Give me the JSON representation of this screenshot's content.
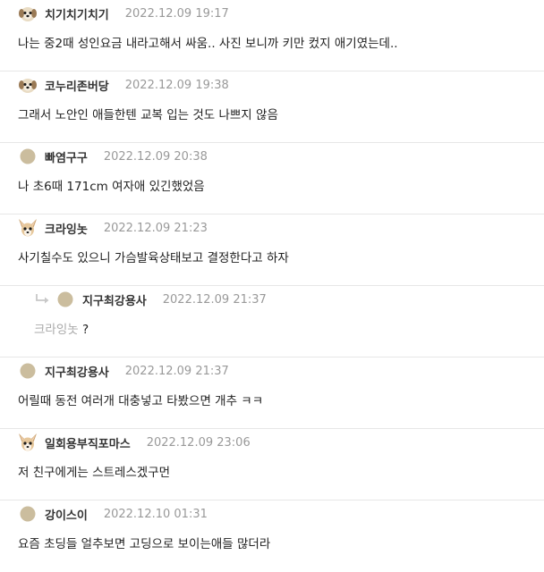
{
  "comments": [
    {
      "author": "치기치기치기",
      "time": "2022.12.09 19:17",
      "avatar": "puppy-avatar",
      "text": "나는 중2때 성인요금 내라고해서 싸움.. 사진 보니까 키만 컸지 애기였는데.."
    },
    {
      "author": "코누리존버당",
      "time": "2022.12.09 19:38",
      "avatar": "puppy-avatar",
      "text": "그래서 노안인 애들한텐 교복 입는 것도 나쁘지 않음"
    },
    {
      "author": "빠염구구",
      "time": "2022.12.09 20:38",
      "avatar": "plain-circle-avatar",
      "text": "나 초6때 171cm 여자애 있긴했었음"
    },
    {
      "author": "크라잉놋",
      "time": "2022.12.09 21:23",
      "avatar": "chihuahua-avatar",
      "text": "사기칠수도 있으니 가슴발육상태보고 결정한다고 하자"
    },
    {
      "author": "지구최강용사",
      "time": "2022.12.09 21:37",
      "avatar": "plain-circle-avatar",
      "is_reply": true,
      "mention": "크라잉놋",
      "text": "?"
    },
    {
      "author": "지구최강용사",
      "time": "2022.12.09 21:37",
      "avatar": "plain-circle-avatar",
      "text": "어릴때 동전 여러개 대충넣고 타봤으면 개추 ㅋㅋ"
    },
    {
      "author": "일회용부직포마스",
      "time": "2022.12.09 23:06",
      "avatar": "chihuahua-avatar",
      "text": "저 친구에게는 스트레스겠구먼"
    },
    {
      "author": "강이스이",
      "time": "2022.12.10 01:31",
      "avatar": "plain-circle-avatar",
      "text": "요즘 초딩들 얼추보면 고딩으로 보이는애들 많더라"
    }
  ],
  "colors": {
    "divider": "#e6e6e6",
    "time": "#999999",
    "mention": "#aaaaaa",
    "avatar_plain": "#cbbd9e"
  }
}
